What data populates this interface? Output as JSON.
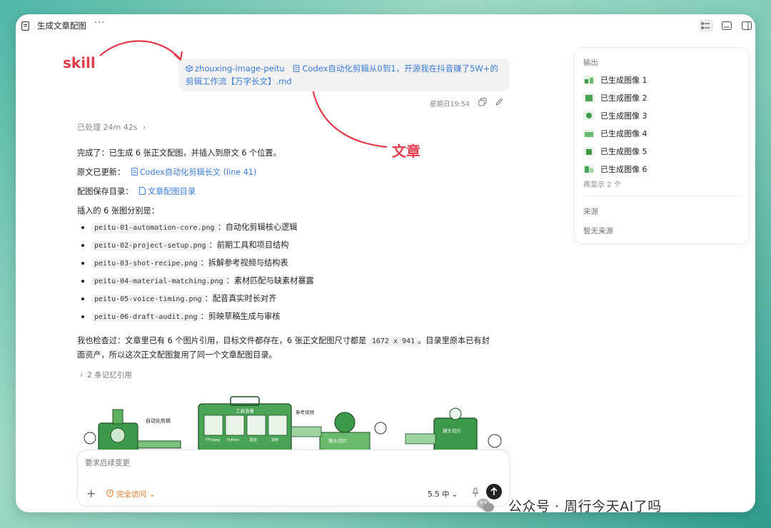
{
  "titlebar": {
    "title": "生成文章配图",
    "more": "···"
  },
  "annotations": {
    "skill": "skill",
    "article": "文章"
  },
  "user_message": {
    "skill_name": "zhouxing-image-peitu",
    "file_name": "Codex自动化剪辑从0到1，开源我在抖音赚了5W+的剪辑工作流【万字长文】.md",
    "timestamp": "星期日19:54"
  },
  "response": {
    "processed": "已处理 24m 42s",
    "summary": "完成了：已生成 6 张正文配图，并插入到原文 6 个位置。",
    "updated_label": "原文已更新：",
    "updated_link": "Codex自动化剪辑长文 (line 41)",
    "dir_label": "配图保存目录：",
    "dir_link": "文章配图目录",
    "list_intro": "插入的 6 张图分别是：",
    "files": [
      {
        "name": "peitu-01-automation-core.png",
        "desc": "：自动化剪辑核心逻辑"
      },
      {
        "name": "peitu-02-project-setup.png",
        "desc": "：前期工具和项目结构"
      },
      {
        "name": "peitu-03-shot-recipe.png",
        "desc": "：拆解参考视频与结构表"
      },
      {
        "name": "peitu-04-material-matching.png",
        "desc": "：素材匹配与缺素材暴露"
      },
      {
        "name": "peitu-05-voice-timing.png",
        "desc": "：配音真实时长对齐"
      },
      {
        "name": "peitu-06-draft-audit.png",
        "desc": "：剪映草稿生成与审核"
      }
    ],
    "check_pre": "我也检查过：文章里已有 6 个图片引用，目标文件都存在，6 张正文配图尺寸都是 ",
    "check_size": "1672 x 941",
    "check_post": "。目录里原本已有封",
    "check_line2": "面资产，所以这次正文配图复用了同一个文章配图目录。",
    "memory": "2 条记忆引用"
  },
  "illustration": {
    "labels": [
      "自动化剪辑",
      "工具准备",
      "FFmpeg",
      "Python",
      "配音",
      "剪映",
      "参考视频",
      "镜头切片",
      "镜头切片"
    ]
  },
  "input": {
    "placeholder": "要求后续变更",
    "access": "完全访问",
    "model": "5.5 中"
  },
  "panel": {
    "output_title": "输出",
    "images": [
      "已生成图像 1",
      "已生成图像 2",
      "已生成图像 3",
      "已生成图像 4",
      "已生成图像 5",
      "已生成图像 6"
    ],
    "show_more": "再显示 2 个",
    "source_title": "来源",
    "no_source": "暂无来源"
  },
  "watermark": {
    "text": "公众号 · 周行今天AI了吗"
  },
  "colors": {
    "accent_link": "#3b7bd6",
    "annotation_red": "#e23c4c",
    "access_orange": "#d9731e",
    "illustration_green": "#3d9a4a"
  }
}
